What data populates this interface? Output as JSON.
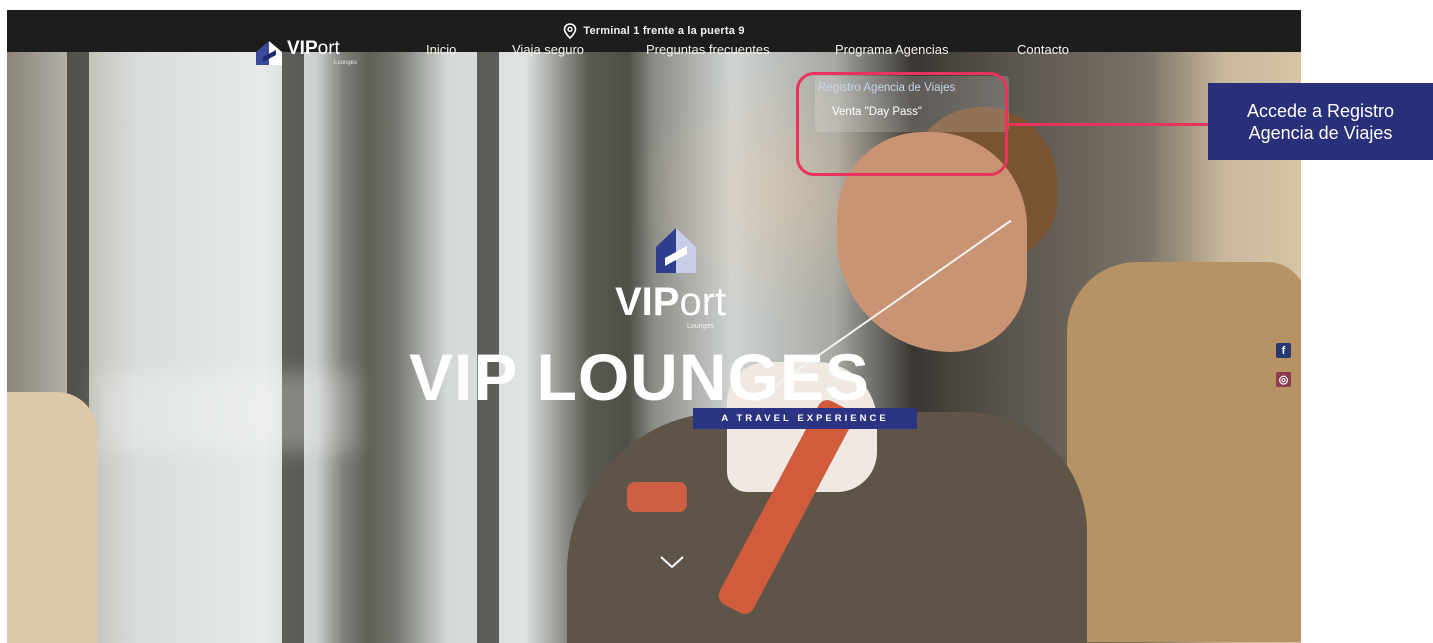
{
  "topbar": {
    "location_text": "Terminal 1 frente a la puerta 9",
    "icon": "location-pin-icon"
  },
  "brand": {
    "name_bold": "VIP",
    "name_light": "ort",
    "sub": "Lounges"
  },
  "nav": {
    "items": [
      {
        "label": "Inicio"
      },
      {
        "label": "Viaja seguro"
      },
      {
        "label": "Preguntas frecuentes"
      },
      {
        "label": "Programa Agencias"
      },
      {
        "label": "Contacto"
      }
    ],
    "dropdown": [
      {
        "label": "Registro Agencia de Viajes"
      },
      {
        "label": "Venta \"Day Pass\""
      }
    ]
  },
  "hero": {
    "logo_bold": "VIP",
    "logo_light": "ort",
    "logo_sub": "Lounges",
    "headline": "VIP LOUNGES",
    "tagline_a": "A TRAVEL",
    "tagline_b": "EXPERIENCE"
  },
  "social": {
    "facebook": "f",
    "instagram": "◎"
  },
  "callout": {
    "line1": "Accede a Registro",
    "line2": "Agencia de Viajes"
  },
  "colors": {
    "accent_highlight": "#e8345d",
    "callout_bg": "#2a2f7a",
    "tagline_bg": "#2b3482",
    "topbar_bg": "#1d1d1d"
  }
}
